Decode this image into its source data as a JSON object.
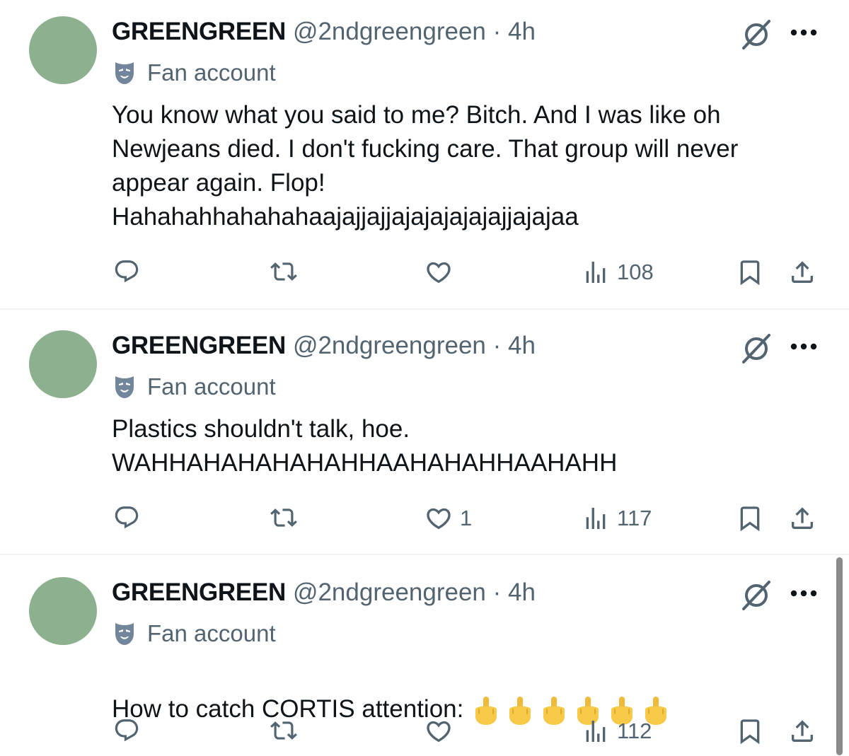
{
  "tweets": [
    {
      "name": "GREENGREEN",
      "meta": "@2ndgreengreen · 4h",
      "label": "Fan account",
      "text": "You know what you said to me? Bitch. And I was like oh\nNewjeans died. I don't fucking care. That group will never\nappear again. Flop!\nHahahahhahahahaajajjajjajajajajajajjajajaa",
      "emojis": [],
      "reply_count": "",
      "retweet_count": "",
      "like_count": "",
      "view_count": "108"
    },
    {
      "name": "GREENGREEN",
      "meta": "@2ndgreengreen · 4h",
      "label": "Fan account",
      "text": "Plastics shouldn't talk, hoe.\nWAHHAHAHAHAHAHHAAHAHAHHAAHAHH",
      "emojis": [],
      "reply_count": "",
      "retweet_count": "",
      "like_count": "1",
      "view_count": "117"
    },
    {
      "name": "GREENGREEN",
      "meta": "@2ndgreengreen · 4h",
      "label": "Fan account",
      "text": "How to catch CORTIS attention:",
      "emojis": [
        "middle-finger-emoji",
        "middle-finger-emoji",
        "middle-finger-emoji",
        "middle-finger-emoji",
        "middle-finger-emoji",
        "middle-finger-emoji"
      ],
      "reply_count": "",
      "retweet_count": "",
      "like_count": "",
      "view_count": "112"
    }
  ],
  "colors": {
    "avatar": "#8db08e",
    "secondary_text": "#536471",
    "primary_text": "#0f1419",
    "divider": "#eff3f4",
    "emoji": "#f7c948"
  },
  "icons": [
    "reply-icon",
    "retweet-icon",
    "like-icon",
    "views-icon",
    "bookmark-icon",
    "share-icon",
    "grok-icon",
    "more-icon",
    "mask-icon"
  ]
}
